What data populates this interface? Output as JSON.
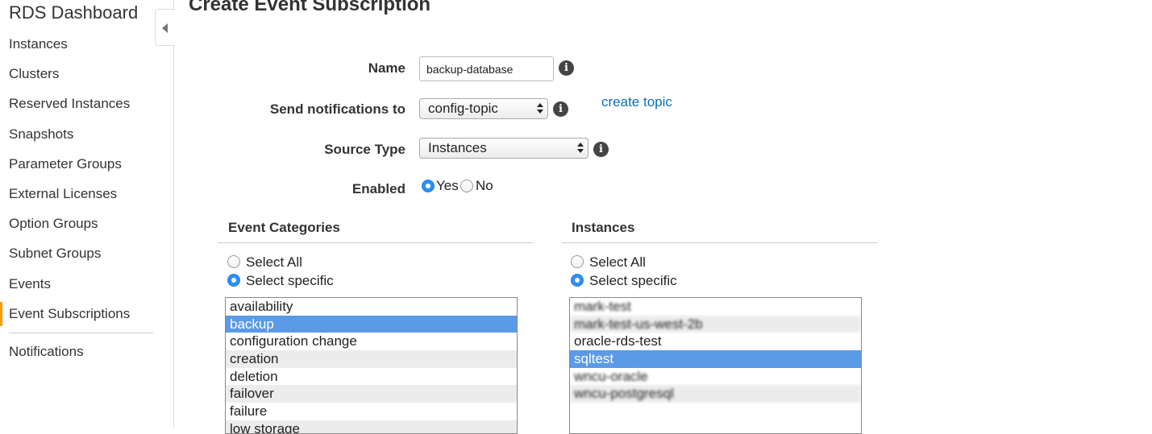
{
  "sidebar": {
    "title": "RDS Dashboard",
    "items": [
      {
        "label": "Instances"
      },
      {
        "label": "Clusters"
      },
      {
        "label": "Reserved Instances"
      },
      {
        "label": "Snapshots"
      },
      {
        "label": "Parameter Groups"
      },
      {
        "label": "External Licenses"
      },
      {
        "label": "Option Groups"
      },
      {
        "label": "Subnet Groups"
      },
      {
        "label": "Events"
      },
      {
        "label": "Event Subscriptions",
        "active": true
      }
    ],
    "bottom_items": [
      {
        "label": "Notifications"
      }
    ]
  },
  "page": {
    "title": "Create Event Subscription"
  },
  "form": {
    "name_label": "Name",
    "name_value": "backup-database",
    "send_label": "Send notifications to",
    "send_value": "config-topic",
    "create_topic_link": "create topic",
    "source_type_label": "Source Type",
    "source_type_value": "Instances",
    "enabled_label": "Enabled",
    "enabled_yes": "Yes",
    "enabled_no": "No",
    "enabled_selected": "Yes"
  },
  "event_categories": {
    "heading": "Event Categories",
    "select_all": "Select All",
    "select_specific": "Select specific",
    "mode_selected": "Select specific",
    "items": [
      "availability",
      "backup",
      "configuration change",
      "creation",
      "deletion",
      "failover",
      "failure",
      "low storage"
    ],
    "selected": "backup"
  },
  "instances": {
    "heading": "Instances",
    "select_all": "Select All",
    "select_specific": "Select specific",
    "mode_selected": "Select specific",
    "items": [
      "mark-test",
      "mark-test-us-west-2b",
      "oracle-rds-test",
      "sqltest",
      "wncu-oracle",
      "wncu-postgresql"
    ],
    "selected": "sqltest"
  },
  "colors": {
    "accent_active": "#ff9900",
    "link": "#0a6eb4",
    "selection": "#5b9ae6",
    "radio_on": "#2d8ff3"
  }
}
